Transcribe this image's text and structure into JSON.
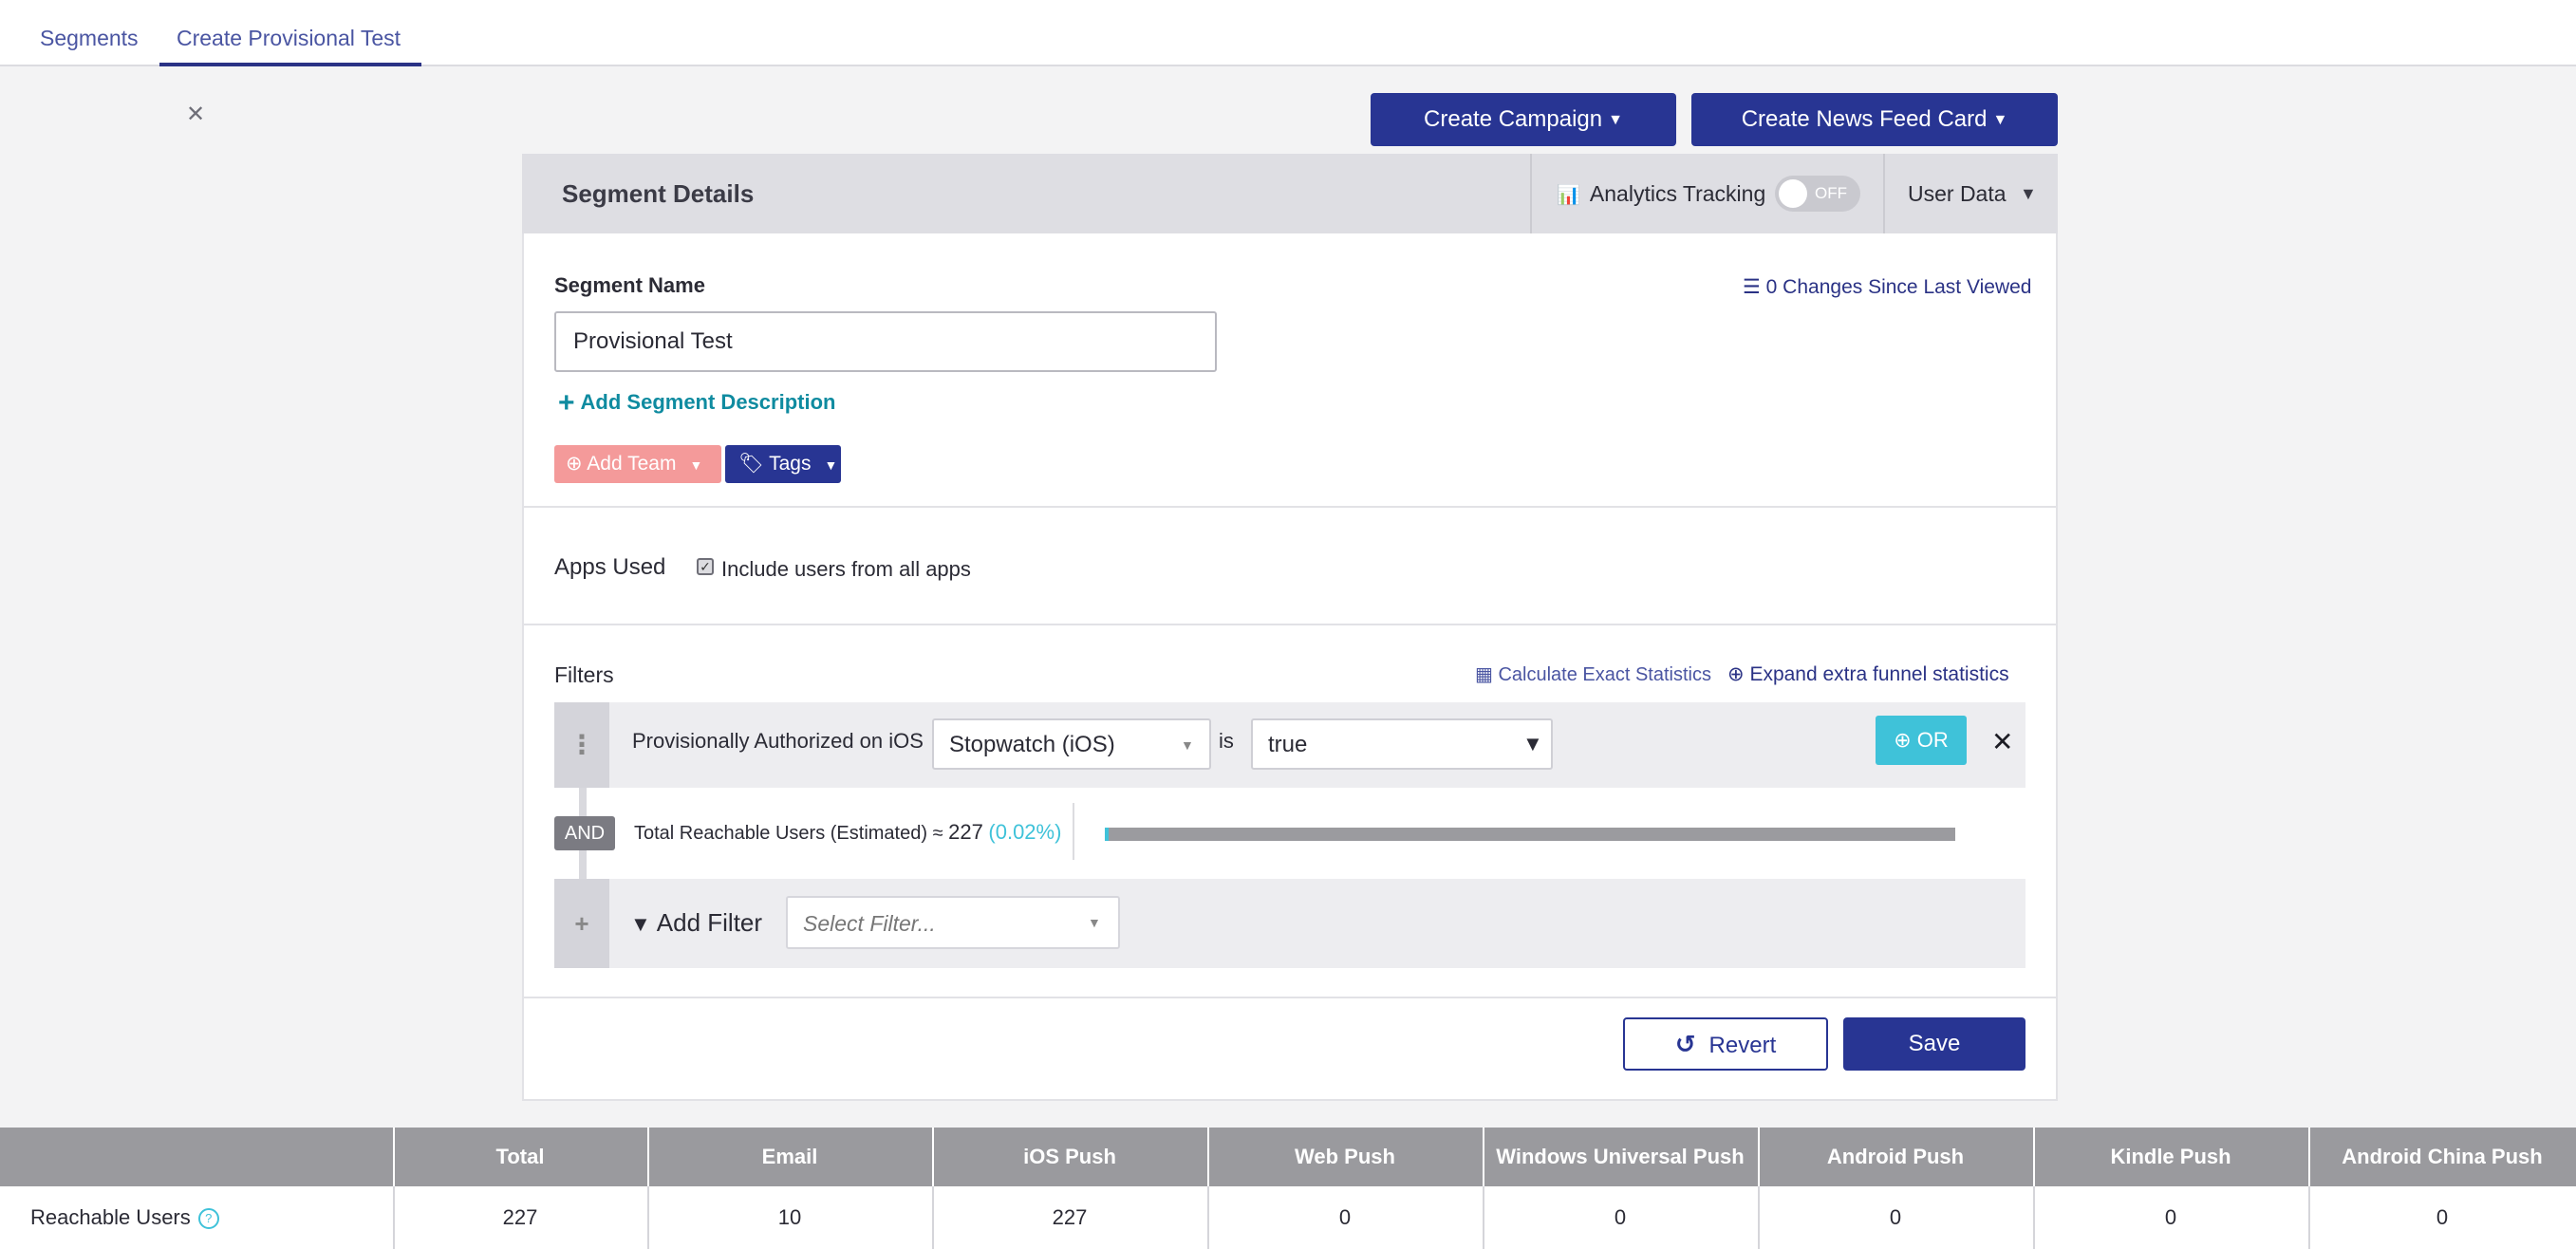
{
  "tabs": [
    {
      "label": "Segments"
    },
    {
      "label": "Create Provisional Test"
    }
  ],
  "header_buttons": {
    "create_campaign": "Create Campaign",
    "create_news_feed": "Create News Feed Card"
  },
  "panel": {
    "title": "Segment Details",
    "analytics_label": "Analytics Tracking",
    "analytics_state": "OFF",
    "user_data": "User Data"
  },
  "segment": {
    "name_label": "Segment Name",
    "name_value": "Provisional Test",
    "changes_link": "0 Changes Since Last Viewed",
    "add_description": "Add Segment Description",
    "add_team": "Add Team",
    "tags": "Tags"
  },
  "apps_used": {
    "label": "Apps Used",
    "checkbox_label": "Include users from all apps",
    "checked": true
  },
  "filters": {
    "label": "Filters",
    "calc_stats": "Calculate Exact Statistics",
    "expand_stats": "Expand extra funnel statistics",
    "filter_name": "Provisionally Authorized on iOS",
    "app_value": "Stopwatch (iOS)",
    "operator": "is",
    "value": "true",
    "or_label": "OR",
    "and_label": "AND",
    "reachable_text": "Total Reachable Users (Estimated) ≈",
    "reachable_count": "227",
    "reachable_pct": "(0.02%)",
    "reachable_fraction": 0.0002,
    "add_filter_label": "Add Filter",
    "select_filter_placeholder": "Select Filter..."
  },
  "actions": {
    "revert": "Revert",
    "save": "Save"
  },
  "table": {
    "row_label": "Reachable Users",
    "headers": [
      "Total",
      "Email",
      "iOS Push",
      "Web Push",
      "Windows Universal Push",
      "Android Push",
      "Kindle Push",
      "Android China Push"
    ],
    "values": [
      "227",
      "10",
      "227",
      "0",
      "0",
      "0",
      "0",
      "0"
    ]
  },
  "colors": {
    "primary": "#283593",
    "accent": "#3fc2d9",
    "team_button": "#f49a9a"
  }
}
